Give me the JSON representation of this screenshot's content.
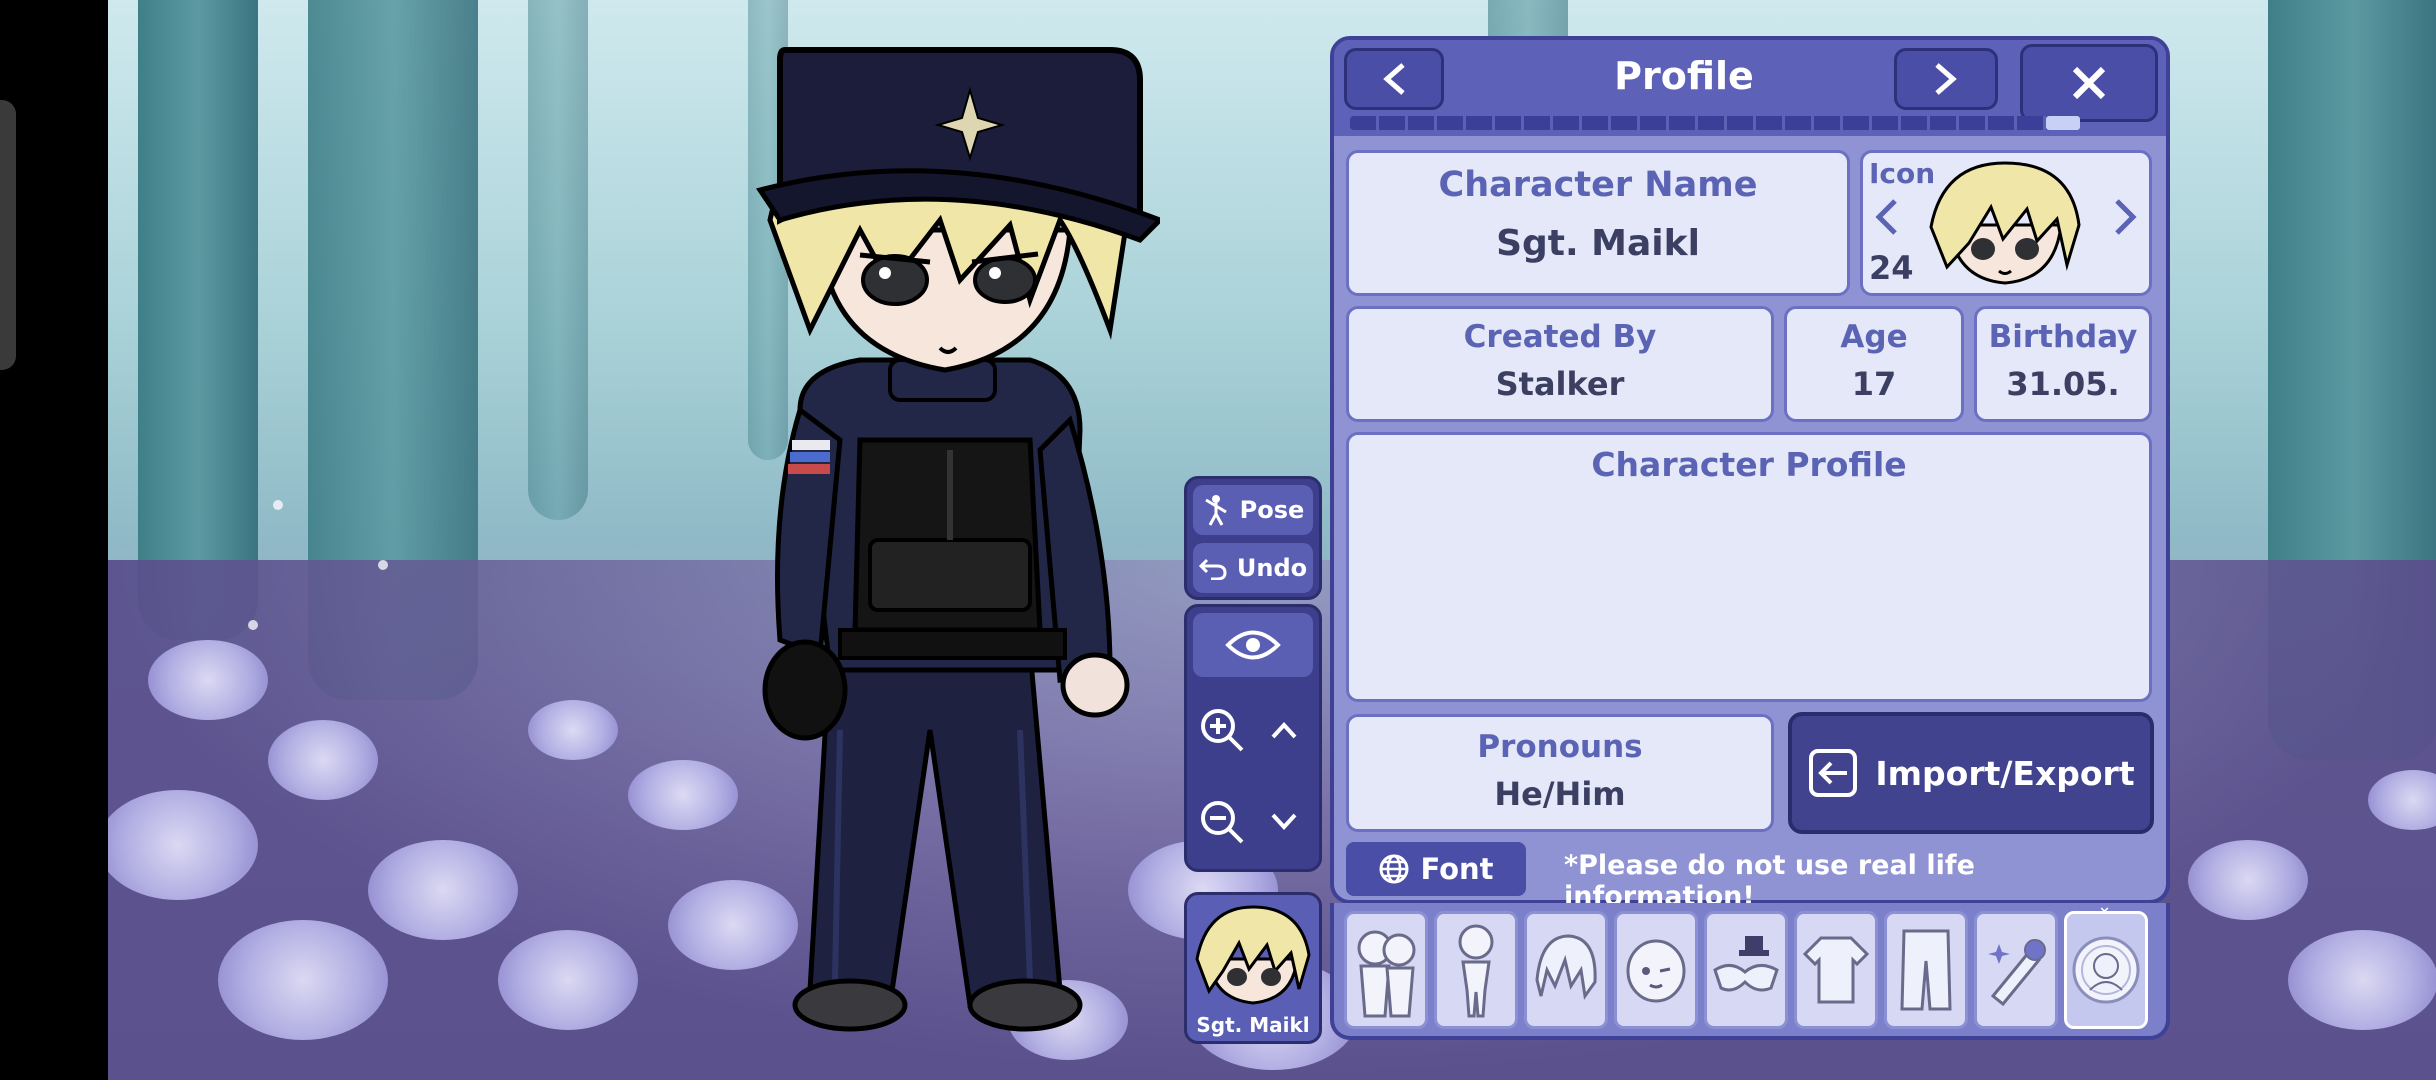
{
  "scene": {
    "colors": {
      "panel": "#8f93d4",
      "panel_header": "#5d61b7",
      "card": "#e5e8f8",
      "label_text": "#5a63b4",
      "value_text": "#3b3f62",
      "accent_dark": "#41438f"
    }
  },
  "side_controls": {
    "pose_label": "Pose",
    "undo_label": "Undo",
    "character_chip_label": "Sgt. Maikl"
  },
  "profile": {
    "title": "Profile",
    "prev_icon": "chevron-left-icon",
    "next_icon": "chevron-right-icon",
    "close_icon": "close-icon",
    "character_name": {
      "label": "Character Name",
      "value": "Sgt. Maikl"
    },
    "icon": {
      "label": "Icon",
      "number": "24"
    },
    "created_by": {
      "label": "Created By",
      "value": "Stalker"
    },
    "age": {
      "label": "Age",
      "value": "17"
    },
    "birthday": {
      "label": "Birthday",
      "value": "31.05."
    },
    "character_profile": {
      "label": "Character Profile",
      "value": ""
    },
    "pronouns": {
      "label": "Pronouns",
      "value": "He/Him"
    },
    "import_export_label": "Import/Export",
    "font_label": "Font",
    "notice": "*Please do not use real life information!"
  },
  "tabs": [
    {
      "icon": "group-characters-icon"
    },
    {
      "icon": "body-icon"
    },
    {
      "icon": "hair-icon"
    },
    {
      "icon": "face-icon"
    },
    {
      "icon": "accessories-icon"
    },
    {
      "icon": "top-clothing-icon"
    },
    {
      "icon": "bottom-clothing-icon"
    },
    {
      "icon": "props-icon"
    },
    {
      "icon": "profile-icon",
      "active": true
    }
  ]
}
